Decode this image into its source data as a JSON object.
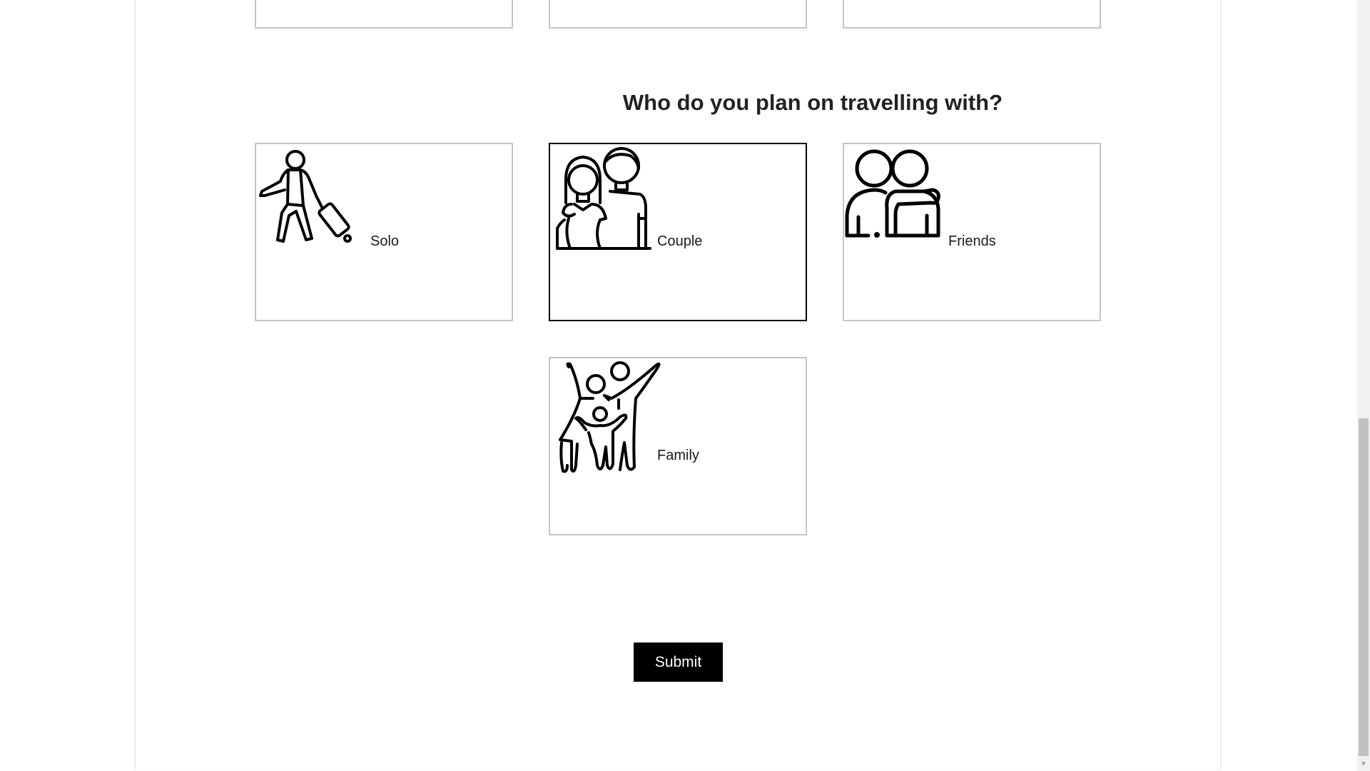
{
  "question": "Who do you plan on travelling with?",
  "options": [
    {
      "label": "Solo",
      "icon": "traveller-with-suitcase-icon",
      "selected": false
    },
    {
      "label": "Couple",
      "icon": "couple-icon",
      "selected": true
    },
    {
      "label": "Friends",
      "icon": "friends-icon",
      "selected": false
    },
    {
      "label": "Family",
      "icon": "family-icon",
      "selected": false
    }
  ],
  "submit_label": "Submit",
  "colors": {
    "card_border": "#c4c4c4",
    "selected_border": "#000000",
    "button_bg": "#000000",
    "button_text": "#ffffff"
  }
}
